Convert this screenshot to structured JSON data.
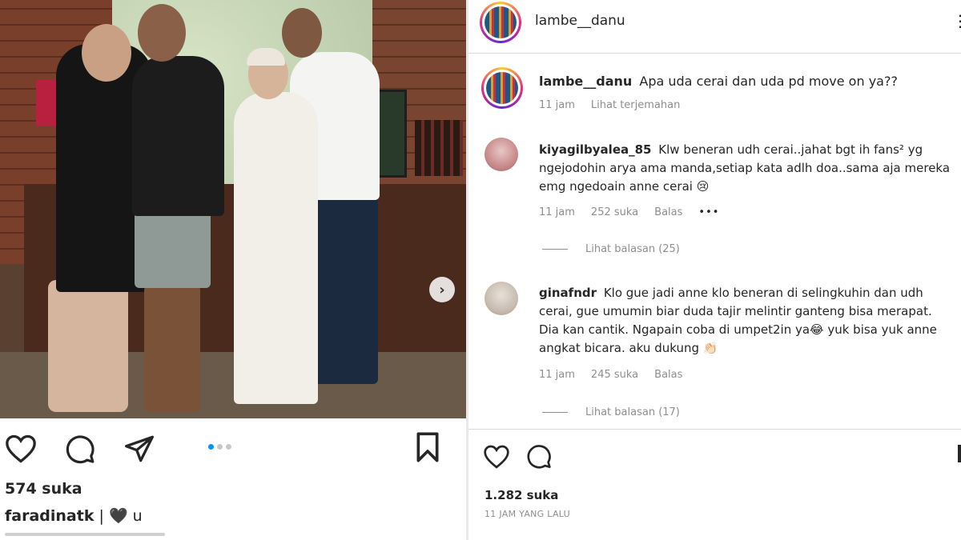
{
  "post": {
    "likes": "574 suka",
    "caption_user": "faradinatk",
    "caption_text": " | ",
    "caption_heart": "🖤",
    "caption_tail": " u",
    "carousel_total": 3,
    "carousel_active": 1
  },
  "detail": {
    "header_username": "lambe__danu",
    "caption": {
      "username": "lambe__danu",
      "text": "Apa uda cerai dan uda pd move on ya??",
      "time": "11 jam",
      "translate": "Lihat terjemahan"
    },
    "comments": [
      {
        "username": "kiyagilbyalea_85",
        "text": "Klw beneran udh cerai..jahat bgt ih fans² yg ngejodohin arya ama manda,setiap kata adlh doa..sama aja mereka emg ngedoain anne cerai 😢",
        "time": "11 jam",
        "likes": "252 suka",
        "reply": "Balas",
        "more": "•••",
        "view_replies": "Lihat balasan (25)"
      },
      {
        "username": "ginafndr",
        "text": "Klo gue jadi anne klo beneran di selingkuhin dan udh cerai, gue umumin biar duda tajir melintir ganteng bisa merapat. Dia kan cantik. Ngapain coba di umpet2in ya😂 yuk bisa yuk anne angkat bicara. aku dukung 👏🏻",
        "time": "11 jam",
        "likes": "245 suka",
        "reply": "Balas",
        "view_replies": "Lihat balasan (17)"
      }
    ],
    "likes": "1.282 suka",
    "timestamp": "11 JAM YANG LALU"
  },
  "icons": {
    "like": "heart-icon",
    "comment": "comment-icon",
    "share": "paper-plane-icon",
    "save": "bookmark-icon",
    "next": "chevron-right-icon",
    "more": "more-icon"
  },
  "colors": {
    "text": "#262626",
    "muted": "#8e8e8e",
    "accent": "#0095f6",
    "divider": "#dbdbdb"
  }
}
